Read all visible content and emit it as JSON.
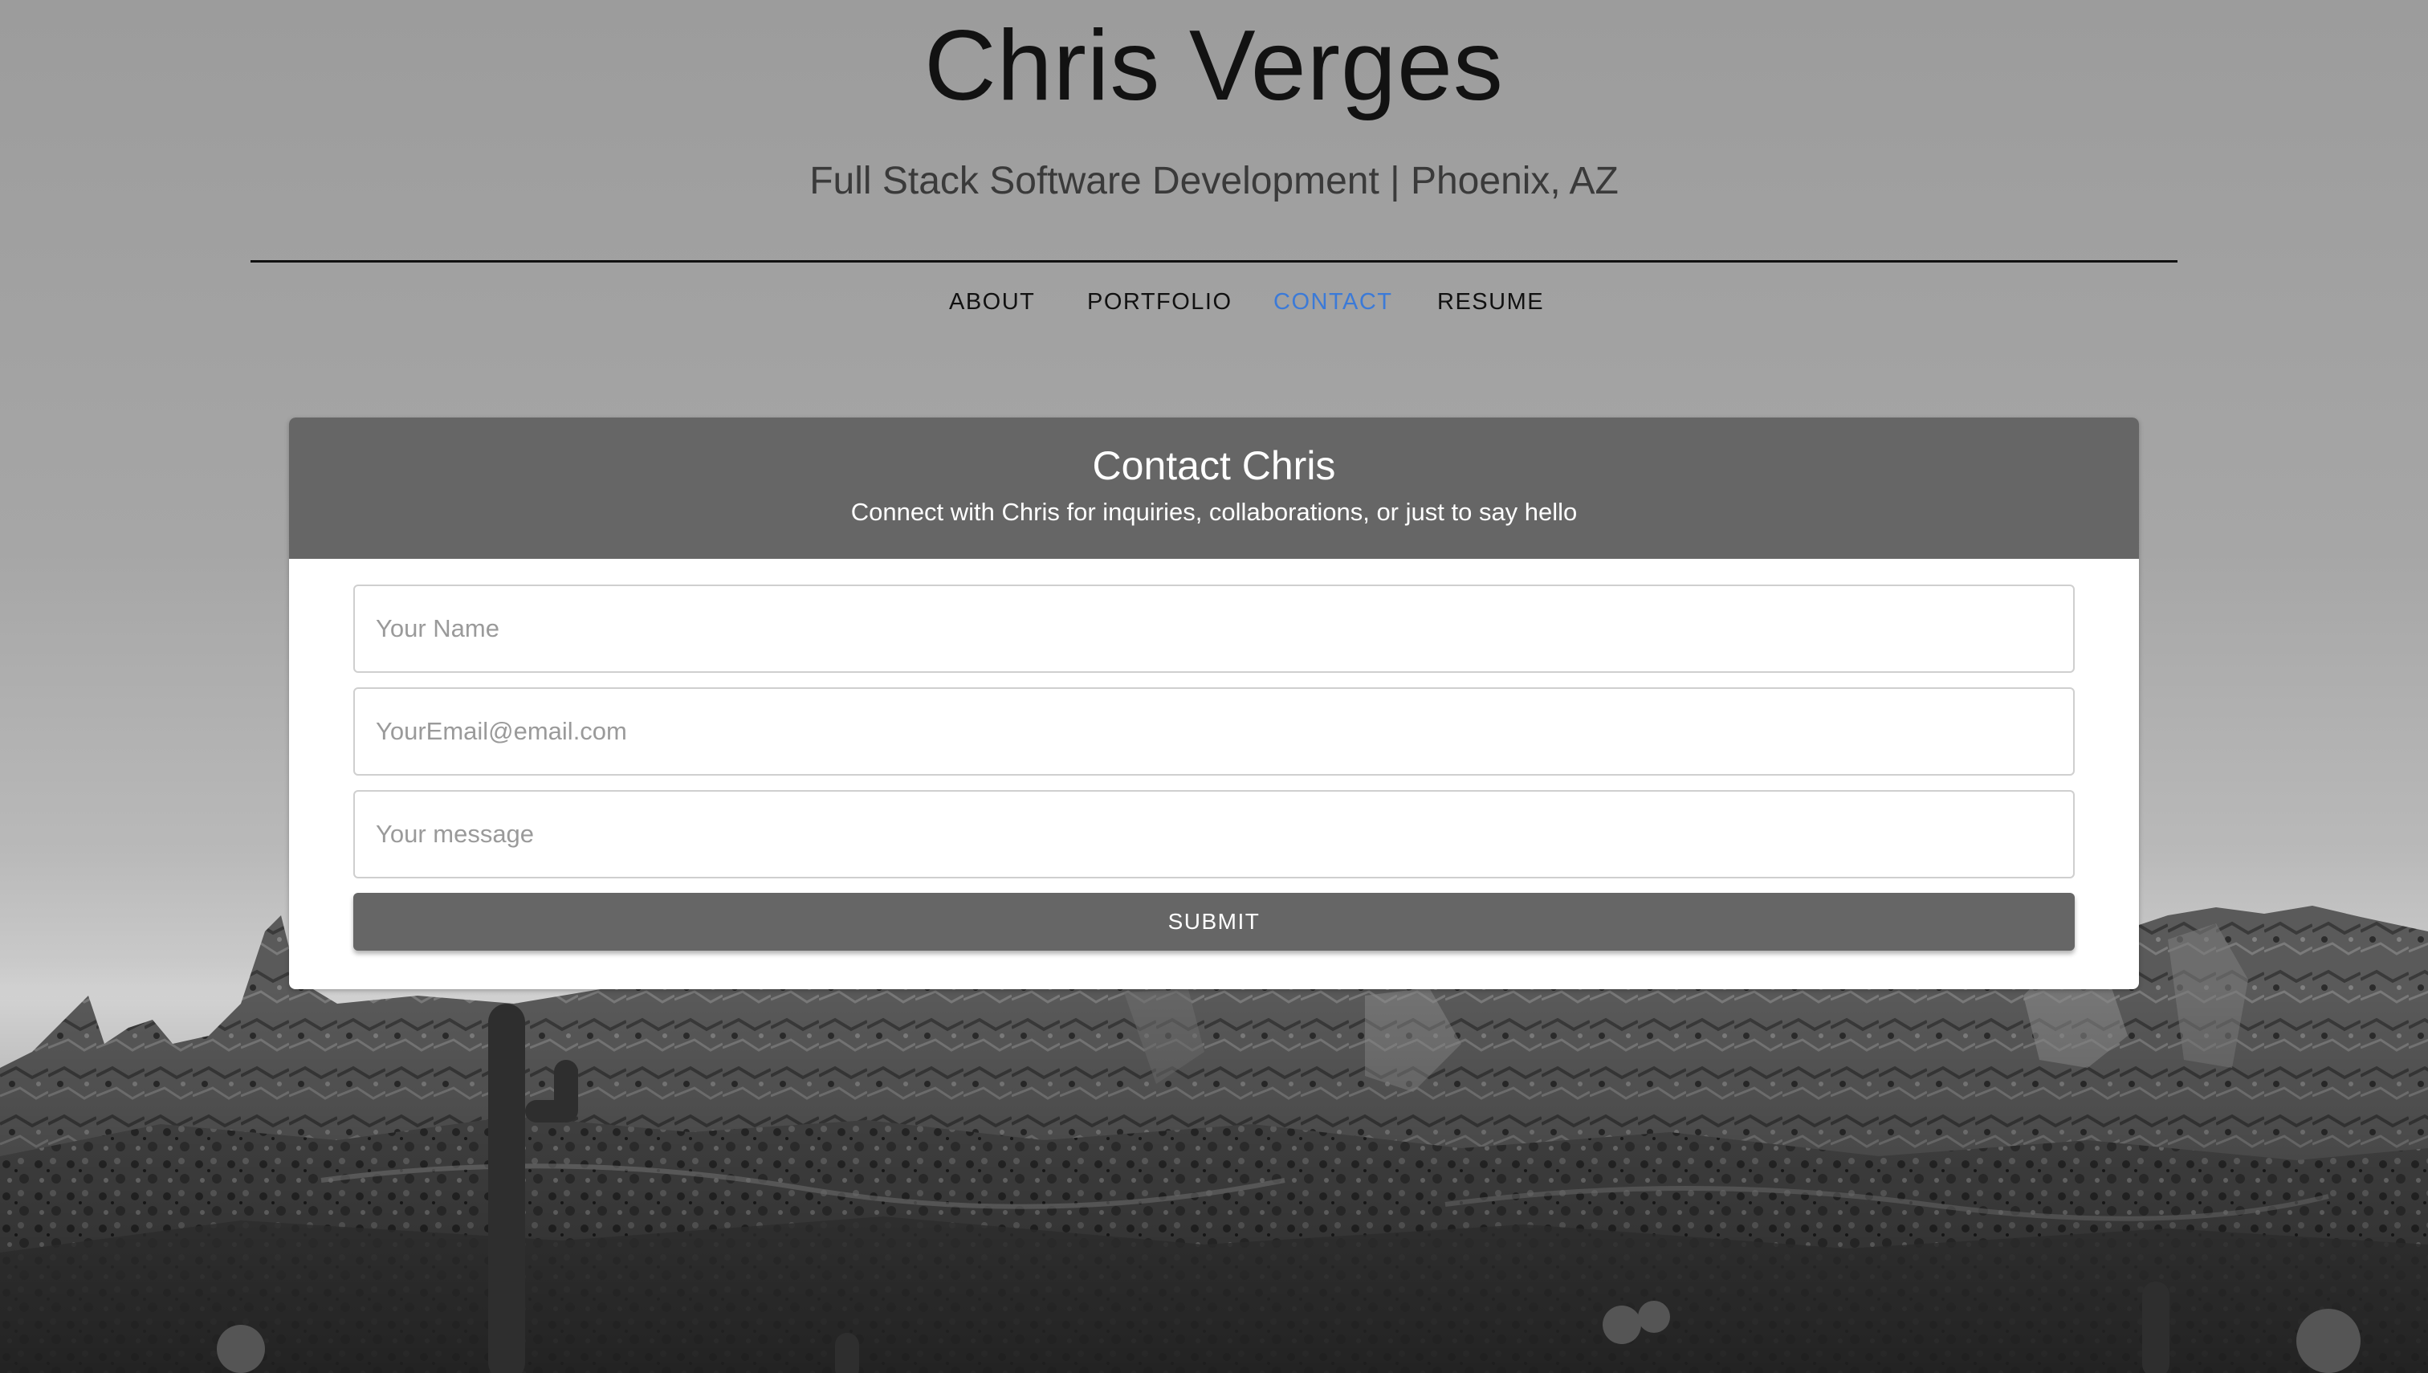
{
  "site": {
    "title": "Chris Verges",
    "tagline": "Full Stack Software Development | Phoenix, AZ"
  },
  "nav": {
    "items": [
      {
        "label": "ABOUT"
      },
      {
        "label": "PORTFOLIO"
      },
      {
        "label": "CONTACT",
        "active": true
      },
      {
        "label": "RESUME"
      }
    ],
    "active_color": "#3b7ad8"
  },
  "contact": {
    "title": "Contact Chris",
    "subtitle": "Connect with Chris for inquiries, collaborations, or just to say hello",
    "name_placeholder": "Your Name",
    "email_placeholder": "YourEmail@email.com",
    "message_placeholder": "Your message",
    "submit_label": "SUBMIT",
    "header_color": "#666666"
  }
}
